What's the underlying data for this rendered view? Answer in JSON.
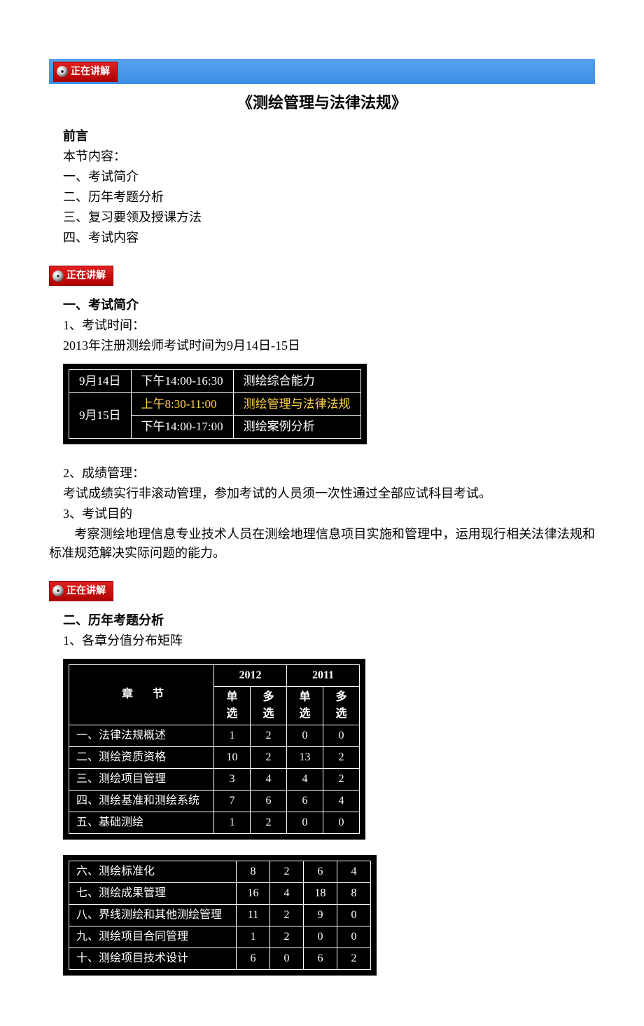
{
  "badge_label": "正在讲解",
  "title": "《测绘管理与法律法规》",
  "preface": {
    "heading": "前言",
    "lead": "本节内容：",
    "items": [
      "一、考试简介",
      "二、历年考题分析",
      "三、复习要领及授课方法",
      "四、考试内容"
    ]
  },
  "section1": {
    "heading": "一、考试简介",
    "p1_label": "1、考试时间：",
    "p1_line": "2013年注册测绘师考试时间为9月14日-15日",
    "schedule": [
      {
        "date": "9月14日",
        "time": "下午14:00-16:30",
        "subject": "测绘综合能力",
        "hl": false
      },
      {
        "date": "9月15日",
        "time": "上午8:30-11:00",
        "subject": "测绘管理与法律法规",
        "hl": true
      },
      {
        "date": "9月15日",
        "time": "下午14:00-17:00",
        "subject": "测绘案例分析",
        "hl": false
      }
    ],
    "p2_label": "2、成绩管理：",
    "p2_line": "考试成绩实行非滚动管理，参加考试的人员须一次性通过全部应试科目考试。",
    "p3_label": "3、考试目的",
    "p3_line": "　　考察测绘地理信息专业技术人员在测绘地理信息项目实施和管理中，运用现行相关法律法规和标准规范解决实际问题的能力。"
  },
  "section2": {
    "heading": "二、历年考题分析",
    "p1_label": "1、各章分值分布矩阵",
    "table_head": {
      "chapter": "章 节",
      "y2012": "2012",
      "y2011": "2011",
      "single": "单选",
      "multi": "多选"
    },
    "chart_data": [
      {
        "type": "table",
        "columns": [
          "章节",
          "2012单选",
          "2012多选",
          "2011单选",
          "2011多选"
        ],
        "rows": [
          {
            "label": "一、法律法规概述",
            "v": [
              1,
              2,
              0,
              0
            ]
          },
          {
            "label": "二、测绘资质资格",
            "v": [
              10,
              2,
              13,
              2
            ]
          },
          {
            "label": "三、测绘项目管理",
            "v": [
              3,
              4,
              4,
              2
            ]
          },
          {
            "label": "四、测绘基准和测绘系统",
            "v": [
              7,
              6,
              6,
              4
            ]
          },
          {
            "label": "五、基础测绘",
            "v": [
              1,
              2,
              0,
              0
            ]
          }
        ]
      },
      {
        "type": "table",
        "columns": [
          "章节",
          "2012单选",
          "2012多选",
          "2011单选",
          "2011多选"
        ],
        "rows": [
          {
            "label": "六、测绘标准化",
            "v": [
              8,
              2,
              6,
              4
            ]
          },
          {
            "label": "七、测绘成果管理",
            "v": [
              16,
              4,
              18,
              8
            ]
          },
          {
            "label": "八、界线测绘和其他测绘管理",
            "v": [
              11,
              2,
              9,
              0
            ]
          },
          {
            "label": "九、测绘项目合同管理",
            "v": [
              1,
              2,
              0,
              0
            ]
          },
          {
            "label": "十、测绘项目技术设计",
            "v": [
              6,
              0,
              6,
              2
            ]
          }
        ]
      }
    ]
  }
}
